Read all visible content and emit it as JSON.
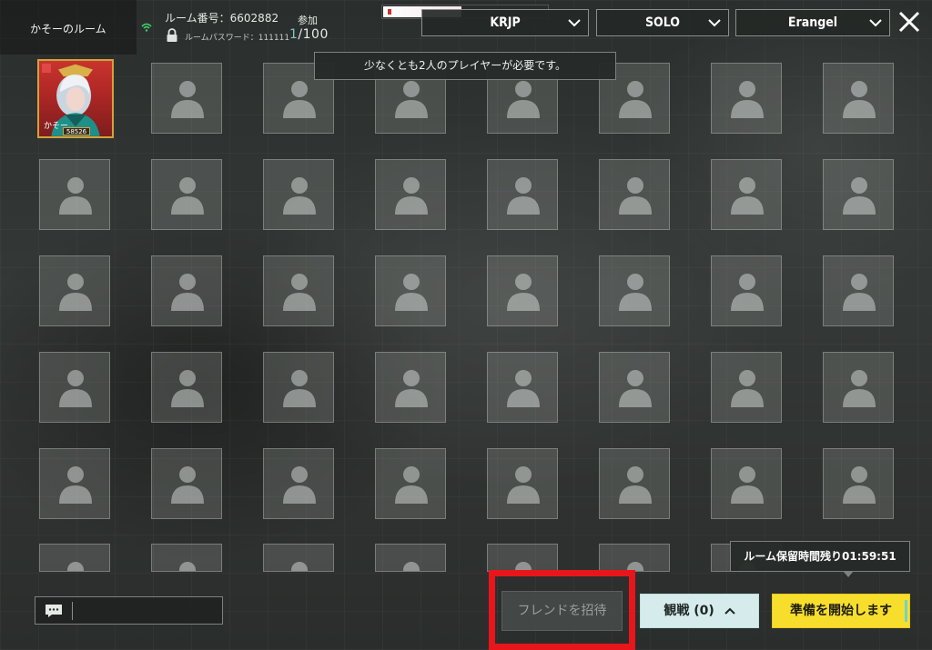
{
  "header": {
    "room_name": "かそーのルーム",
    "room_number_label": "ルーム番号：6602882",
    "password_label": "ルームパスワード：111111",
    "join_label": "参加",
    "player_current": "1",
    "player_total": "/100"
  },
  "progress": {
    "fill_fraction": 0.47
  },
  "dropdowns": {
    "server": "KRJP",
    "mode": "SOLO",
    "map": "Erangel"
  },
  "notice": "少なくとも2人のプレイヤーが必要です。",
  "player_slot": {
    "name": "かそー…",
    "badge": "58526"
  },
  "timer": "ルーム保留時間残り01:59:51",
  "buttons": {
    "invite": "フレンドを招待",
    "spectate": "観戦 (0)",
    "ready": "準備を開始します"
  },
  "icons": {
    "wifi": "wifi-icon",
    "lock": "lock-icon",
    "close": "close-icon",
    "chat": "chat-icon",
    "slot": "person-silhouette-icon",
    "chevron_down": "chevron-down-icon",
    "chevron_up": "chevron-up-icon"
  },
  "colors": {
    "highlight": "#e8161a",
    "ready": "#f7de2d",
    "spectate": "#d6ecec",
    "accent_count": "#7ec9c0"
  }
}
